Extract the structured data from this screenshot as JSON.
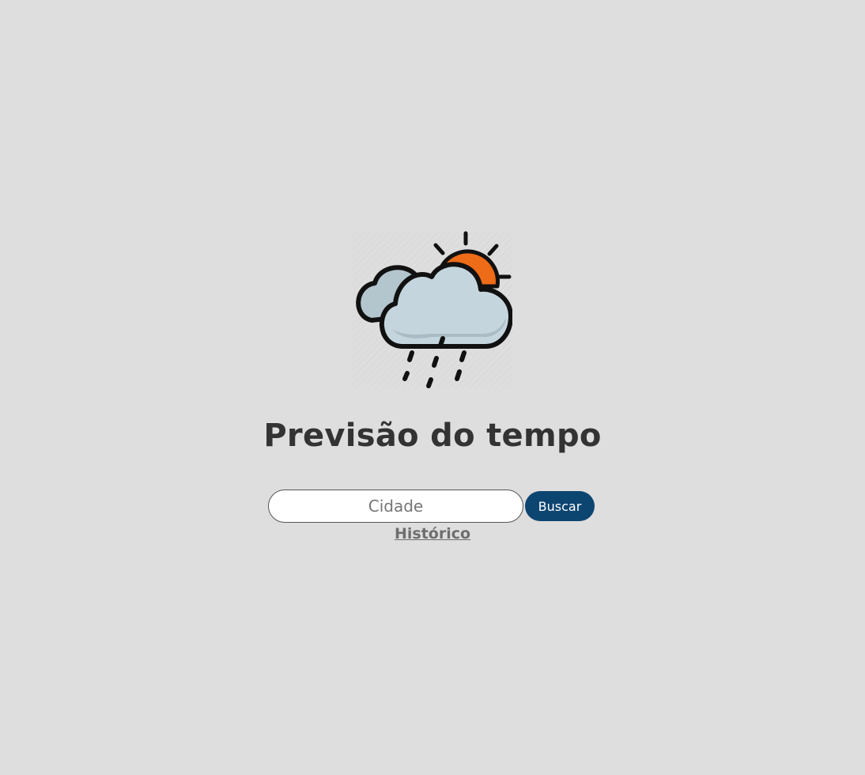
{
  "logo": {
    "icon": "cloud-sun-rain-icon",
    "colors": {
      "sun": "#ee6b17",
      "cloud": "#c4d5dd",
      "outline": "#111111"
    }
  },
  "header": {
    "title": "Previsão do tempo"
  },
  "search": {
    "placeholder": "Cidade",
    "value": "",
    "button_label": "Buscar"
  },
  "links": {
    "history_label": "Histórico"
  },
  "colors": {
    "background": "#dedede",
    "button": "#0d4571",
    "title": "#333333",
    "link": "#6e6e6e"
  }
}
